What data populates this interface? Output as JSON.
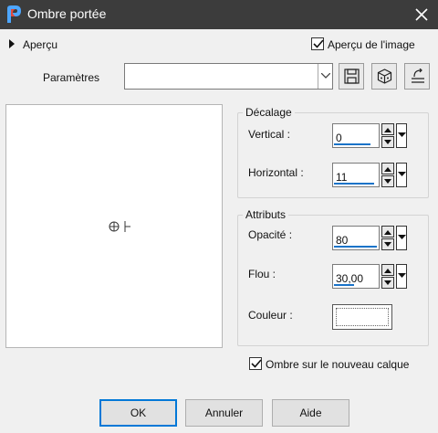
{
  "window": {
    "title": "Ombre portée"
  },
  "preview_section": {
    "label": "Aperçu",
    "image_preview_label": "Aperçu de l'image",
    "image_preview_checked": true
  },
  "presets": {
    "label": "Paramètres",
    "value": "",
    "buttons": [
      "save-icon",
      "reset-icon",
      "edit-preset-icon"
    ]
  },
  "offset": {
    "title": "Décalage",
    "vertical": {
      "label": "Vertical :",
      "value": "0"
    },
    "horizontal": {
      "label": "Horizontal :",
      "value": "11"
    }
  },
  "attributes": {
    "title": "Attributs",
    "opacity": {
      "label": "Opacité :",
      "value": "80"
    },
    "blur": {
      "label": "Flou :",
      "value": "30,00"
    },
    "color": {
      "label": "Couleur :",
      "value_color": "#ffffff"
    }
  },
  "new_layer": {
    "label": "Ombre sur le nouveau calque",
    "checked": true
  },
  "buttons": {
    "ok": "OK",
    "cancel": "Annuler",
    "help": "Aide"
  },
  "colors": {
    "titlebar": "#3c3c3c",
    "accent": "#1a73c8",
    "default_button_border": "#0078d7"
  }
}
